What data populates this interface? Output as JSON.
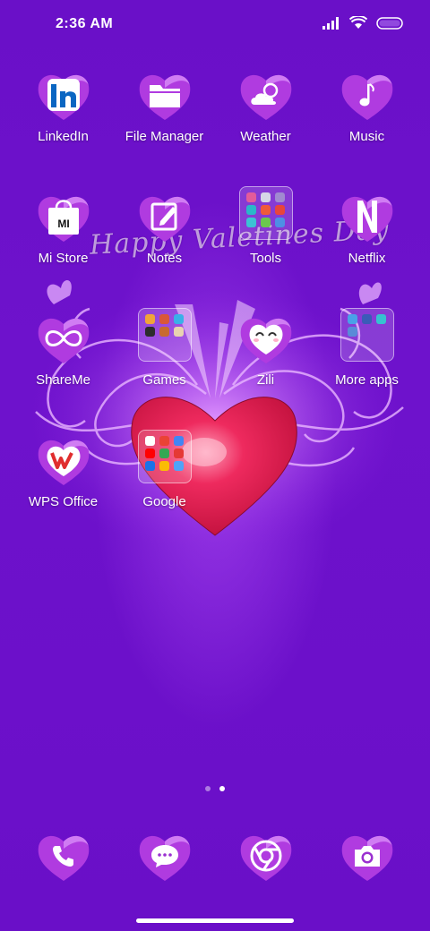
{
  "status_bar": {
    "time": "2:36 AM",
    "icons": [
      "signal-icon",
      "wifi-icon",
      "battery-icon"
    ]
  },
  "wallpaper": {
    "caption": "Happy Valetines Day",
    "colors": {
      "background": "#6a10c8",
      "heart": "#e0174a"
    }
  },
  "apps": [
    {
      "label": "LinkedIn",
      "icon": "linkedin-icon"
    },
    {
      "label": "File Manager",
      "icon": "folder-icon"
    },
    {
      "label": "Weather",
      "icon": "weather-icon"
    },
    {
      "label": "Music",
      "icon": "music-note-icon"
    },
    {
      "label": "Mi Store",
      "icon": "mi-store-bag-icon"
    },
    {
      "label": "Notes",
      "icon": "notes-pen-icon"
    },
    {
      "label": "Tools",
      "icon": "folder-tools-icon"
    },
    {
      "label": "Netflix",
      "icon": "netflix-icon"
    },
    {
      "label": "ShareMe",
      "icon": "shareme-infinity-icon"
    },
    {
      "label": "Games",
      "icon": "folder-games-icon"
    },
    {
      "label": "Zili",
      "icon": "zili-face-icon"
    },
    {
      "label": "More apps",
      "icon": "folder-more-apps-icon"
    },
    {
      "label": "WPS Office",
      "icon": "wps-office-icon"
    },
    {
      "label": "Google",
      "icon": "folder-google-icon"
    }
  ],
  "mi_store_logo": "MI",
  "page_indicator": {
    "pages": 2,
    "current": 2
  },
  "dock": [
    {
      "icon": "phone-icon"
    },
    {
      "icon": "messages-icon"
    },
    {
      "icon": "chrome-icon"
    },
    {
      "icon": "camera-icon"
    }
  ]
}
